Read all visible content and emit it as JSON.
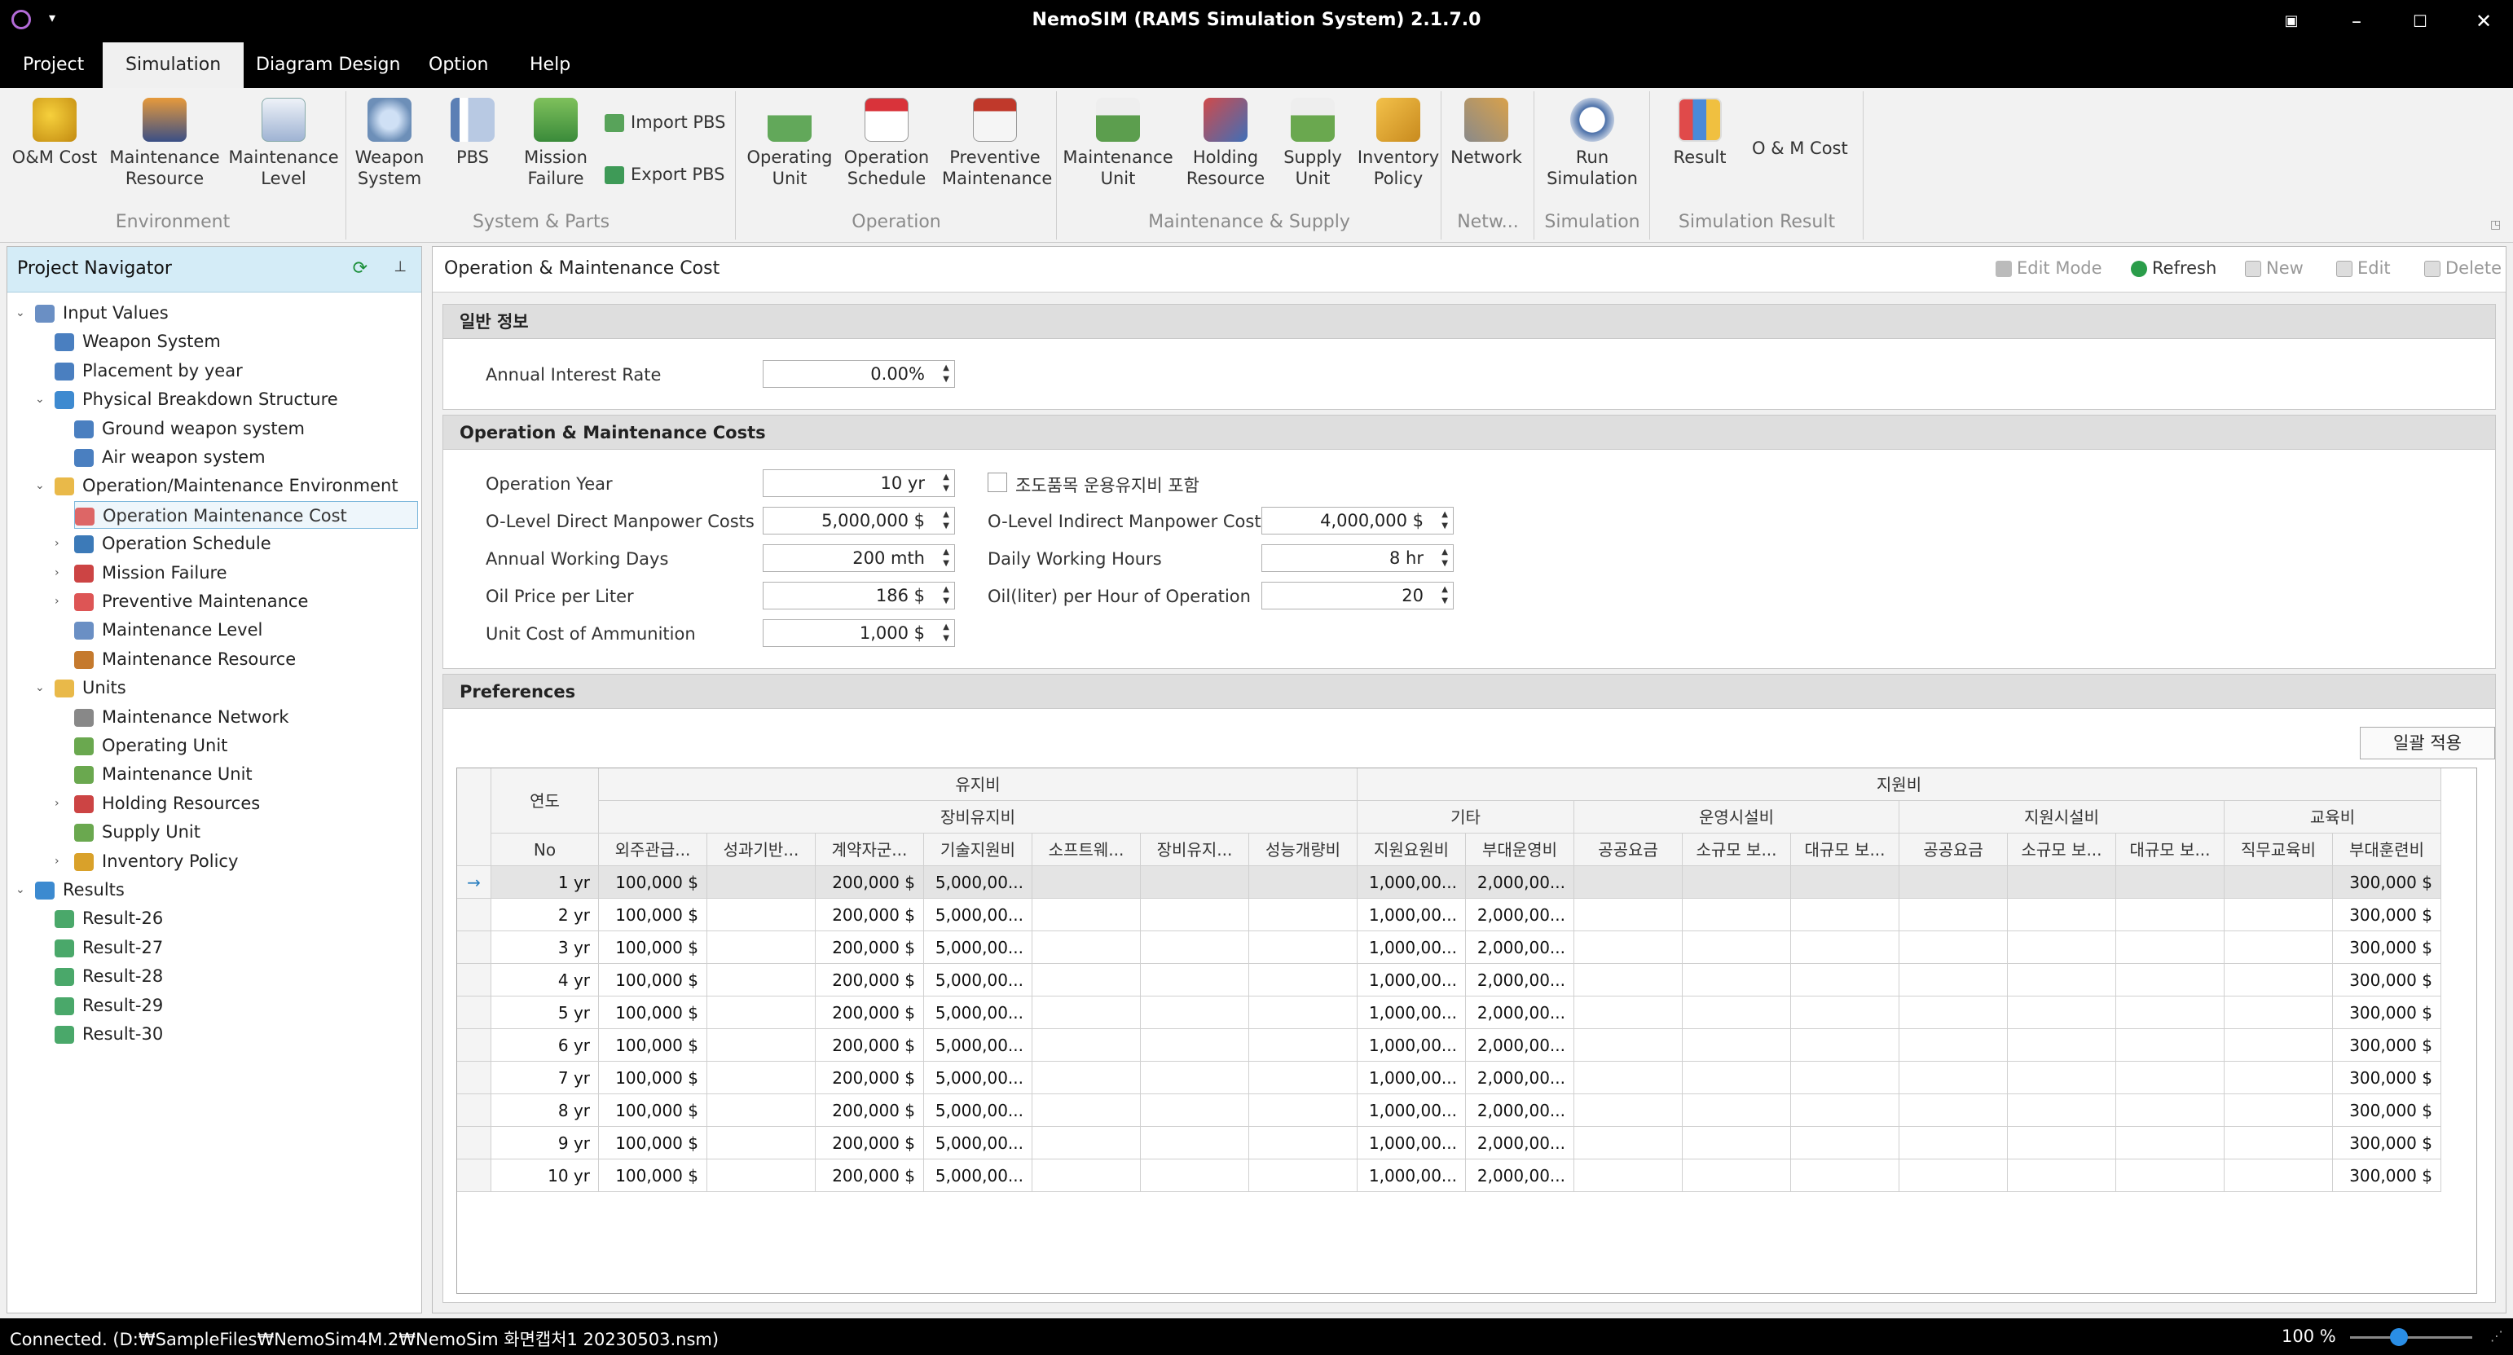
{
  "window": {
    "title": "NemoSIM (RAMS Simulation System) 2.1.7.0"
  },
  "menu": {
    "tabs": [
      "Project",
      "Simulation",
      "Diagram Design",
      "Option",
      "Help"
    ]
  },
  "ribbon": {
    "environment": {
      "om_cost": "O&M Cost",
      "maint_resource": [
        "Maintenance",
        "Resource"
      ],
      "maint_level": [
        "Maintenance",
        "Level"
      ],
      "group": "Environment"
    },
    "system_parts": {
      "weapon_system": [
        "Weapon",
        "System"
      ],
      "pbs": "PBS",
      "mission_failure": [
        "Mission",
        "Failure"
      ],
      "import_pbs": "Import PBS",
      "export_pbs": "Export PBS",
      "group": "System & Parts"
    },
    "operation": {
      "operating_unit": [
        "Operating",
        "Unit"
      ],
      "operation_schedule": [
        "Operation",
        "Schedule"
      ],
      "preventive_maintenance": [
        "Preventive",
        "Maintenance"
      ],
      "group": "Operation"
    },
    "maint_supply": {
      "maint_unit": [
        "Maintenance",
        "Unit"
      ],
      "holding_resource": [
        "Holding",
        "Resource"
      ],
      "supply_unit": [
        "Supply",
        "Unit"
      ],
      "inventory_policy": [
        "Inventory",
        "Policy"
      ],
      "group": "Maintenance & Supply"
    },
    "network": {
      "network": "Network",
      "group": "Netw..."
    },
    "simulation": {
      "run": [
        "Run",
        "Simulation"
      ],
      "group": "Simulation"
    },
    "result": {
      "result": "Result",
      "om_cost": "O & M Cost",
      "group": "Simulation Result"
    }
  },
  "navigator": {
    "title": "Project Navigator",
    "items": [
      {
        "label": "Input Values",
        "level": 0,
        "expander": "⌄"
      },
      {
        "label": "Weapon System",
        "level": 1,
        "expander": ""
      },
      {
        "label": "Placement by year",
        "level": 1,
        "expander": ""
      },
      {
        "label": "Physical Breakdown Structure",
        "level": 1,
        "expander": "⌄"
      },
      {
        "label": "Ground weapon system",
        "level": 2,
        "expander": ""
      },
      {
        "label": "Air weapon system",
        "level": 2,
        "expander": ""
      },
      {
        "label": "Operation/Maintenance Environment",
        "level": 1,
        "expander": "⌄"
      },
      {
        "label": "Operation Maintenance Cost",
        "level": 2,
        "expander": "",
        "selected": true
      },
      {
        "label": "Operation Schedule",
        "level": 2,
        "expander": "›"
      },
      {
        "label": "Mission Failure",
        "level": 2,
        "expander": "›"
      },
      {
        "label": "Preventive Maintenance",
        "level": 2,
        "expander": "›"
      },
      {
        "label": "Maintenance Level",
        "level": 2,
        "expander": ""
      },
      {
        "label": "Maintenance Resource",
        "level": 2,
        "expander": ""
      },
      {
        "label": "Units",
        "level": 1,
        "expander": "⌄"
      },
      {
        "label": "Maintenance Network",
        "level": 2,
        "expander": ""
      },
      {
        "label": "Operating Unit",
        "level": 2,
        "expander": ""
      },
      {
        "label": "Maintenance Unit",
        "level": 2,
        "expander": ""
      },
      {
        "label": "Holding Resources",
        "level": 2,
        "expander": "›"
      },
      {
        "label": "Supply Unit",
        "level": 2,
        "expander": ""
      },
      {
        "label": "Inventory Policy",
        "level": 2,
        "expander": "›"
      },
      {
        "label": "Results",
        "level": 0,
        "expander": "⌄"
      },
      {
        "label": "Result-26",
        "level": 1,
        "expander": ""
      },
      {
        "label": "Result-27",
        "level": 1,
        "expander": ""
      },
      {
        "label": "Result-28",
        "level": 1,
        "expander": ""
      },
      {
        "label": "Result-29",
        "level": 1,
        "expander": ""
      },
      {
        "label": "Result-30",
        "level": 1,
        "expander": ""
      }
    ]
  },
  "content": {
    "title": "Operation & Maintenance Cost",
    "toolbar": {
      "edit_mode": "Edit Mode",
      "refresh": "Refresh",
      "new": "New",
      "edit": "Edit",
      "delete": "Delete"
    },
    "general": {
      "header": "일반 정보",
      "annual_interest_rate_label": "Annual Interest Rate",
      "annual_interest_rate": "0.00%"
    },
    "costs": {
      "header": "Operation & Maintenance Costs",
      "operation_year_label": "Operation Year",
      "operation_year": "10 yr",
      "include_label": "조도품목 운용유지비 포함",
      "olevel_direct_label": "O-Level Direct Manpower Costs",
      "olevel_direct": "5,000,000 $",
      "olevel_indirect_label": "O-Level Indirect Manpower Costs",
      "olevel_indirect": "4,000,000 $",
      "annual_days_label": "Annual Working Days",
      "annual_days": "200 mth",
      "daily_hours_label": "Daily Working Hours",
      "daily_hours": "8 hr",
      "oil_price_label": "Oil Price per Liter",
      "oil_price": "186 $",
      "oil_per_hour_label": "Oil(liter) per Hour of Operation",
      "oil_per_hour": "20",
      "ammo_label": "Unit Cost of Ammunition",
      "ammo": "1,000 $"
    },
    "preferences": {
      "header": "Preferences",
      "apply_all": "일괄 적용",
      "group1": {
        "yeondo": "연도",
        "yujibi": "유지비",
        "jiwonbi": "지원비"
      },
      "group2": {
        "jangbi": "장비유지비",
        "gita": "기타",
        "unyeong": "운영시설비",
        "jiwon_facility": "지원시설비",
        "education": "교육비"
      },
      "columns": [
        "No",
        "외주관급...",
        "성과기반...",
        "계약자군...",
        "기술지원비",
        "소프트웨...",
        "장비유지...",
        "성능개량비",
        "지원요원비",
        "부대운영비",
        "공공요금",
        "소규모 보...",
        "대규모 보...",
        "공공요금",
        "소규모 보...",
        "대규모 보...",
        "직무교육비",
        "부대훈련비"
      ],
      "rows": [
        [
          "1 yr",
          "100,000 $",
          "",
          "200,000 $",
          "5,000,00...",
          "",
          "",
          "",
          "1,000,00...",
          "2,000,00...",
          "",
          "",
          "",
          "",
          "",
          "",
          "",
          "300,000 $"
        ],
        [
          "2 yr",
          "100,000 $",
          "",
          "200,000 $",
          "5,000,00...",
          "",
          "",
          "",
          "1,000,00...",
          "2,000,00...",
          "",
          "",
          "",
          "",
          "",
          "",
          "",
          "300,000 $"
        ],
        [
          "3 yr",
          "100,000 $",
          "",
          "200,000 $",
          "5,000,00...",
          "",
          "",
          "",
          "1,000,00...",
          "2,000,00...",
          "",
          "",
          "",
          "",
          "",
          "",
          "",
          "300,000 $"
        ],
        [
          "4 yr",
          "100,000 $",
          "",
          "200,000 $",
          "5,000,00...",
          "",
          "",
          "",
          "1,000,00...",
          "2,000,00...",
          "",
          "",
          "",
          "",
          "",
          "",
          "",
          "300,000 $"
        ],
        [
          "5 yr",
          "100,000 $",
          "",
          "200,000 $",
          "5,000,00...",
          "",
          "",
          "",
          "1,000,00...",
          "2,000,00...",
          "",
          "",
          "",
          "",
          "",
          "",
          "",
          "300,000 $"
        ],
        [
          "6 yr",
          "100,000 $",
          "",
          "200,000 $",
          "5,000,00...",
          "",
          "",
          "",
          "1,000,00...",
          "2,000,00...",
          "",
          "",
          "",
          "",
          "",
          "",
          "",
          "300,000 $"
        ],
        [
          "7 yr",
          "100,000 $",
          "",
          "200,000 $",
          "5,000,00...",
          "",
          "",
          "",
          "1,000,00...",
          "2,000,00...",
          "",
          "",
          "",
          "",
          "",
          "",
          "",
          "300,000 $"
        ],
        [
          "8 yr",
          "100,000 $",
          "",
          "200,000 $",
          "5,000,00...",
          "",
          "",
          "",
          "1,000,00...",
          "2,000,00...",
          "",
          "",
          "",
          "",
          "",
          "",
          "",
          "300,000 $"
        ],
        [
          "9 yr",
          "100,000 $",
          "",
          "200,000 $",
          "5,000,00...",
          "",
          "",
          "",
          "1,000,00...",
          "2,000,00...",
          "",
          "",
          "",
          "",
          "",
          "",
          "",
          "300,000 $"
        ],
        [
          "10 yr",
          "100,000 $",
          "",
          "200,000 $",
          "5,000,00...",
          "",
          "",
          "",
          "1,000,00...",
          "2,000,00...",
          "",
          "",
          "",
          "",
          "",
          "",
          "",
          "300,000 $"
        ]
      ],
      "current_row_indicator": "→"
    }
  },
  "status": {
    "text": "Connected. (D:₩SampleFiles₩NemoSim4M.2₩NemoSim 화면캡처1 20230503.nsm)",
    "zoom": "100 %",
    "zoom_fraction": 0.4
  }
}
